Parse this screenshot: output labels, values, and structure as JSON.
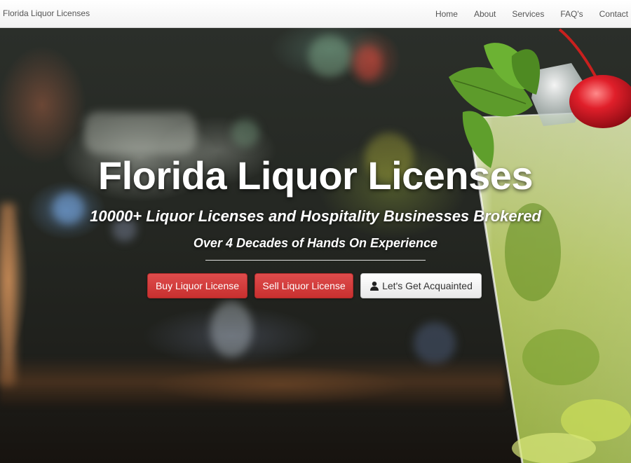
{
  "navbar": {
    "brand": "Florida Liquor Licenses",
    "links": [
      "Home",
      "About",
      "Services",
      "FAQ's",
      "Contact"
    ]
  },
  "hero": {
    "title": "Florida Liquor Licenses",
    "subtitle": "10000+ Liquor Licenses and Hospitality Businesses Brokered",
    "tagline": "Over 4 Decades of Hands On Experience",
    "buttons": {
      "buy": "Buy Liquor License",
      "sell": "Sell Liquor License",
      "meet": "Let's Get Acquainted"
    },
    "meet_icon": "user-icon"
  },
  "colors": {
    "primary_button": "#d63f3e",
    "secondary_button": "#f5f5f5",
    "navbar_bg": "#f8f8f8",
    "text_on_hero": "#ffffff"
  }
}
